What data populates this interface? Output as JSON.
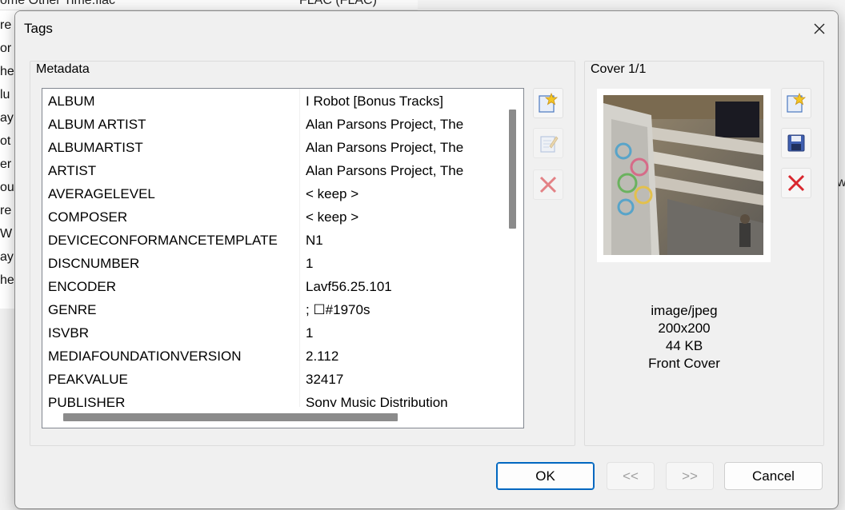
{
  "background": {
    "header_col1": "ome Other Time.flac",
    "header_col2": "FLAC (FLAC)",
    "row_fragments": [
      "re",
      "or",
      "he",
      "lu",
      "ay",
      "ot",
      "er",
      "ou",
      "re",
      "W",
      "ay",
      "he"
    ],
    "edge_text": "w"
  },
  "dialog": {
    "title": "Tags",
    "close_icon": "close-icon"
  },
  "metadata": {
    "group_label": "Metadata",
    "rows": [
      {
        "name": "ALBUM",
        "value": "I Robot [Bonus Tracks]"
      },
      {
        "name": "ALBUM ARTIST",
        "value": "Alan Parsons Project, The"
      },
      {
        "name": "ALBUMARTIST",
        "value": "Alan Parsons Project, The"
      },
      {
        "name": "ARTIST",
        "value": "Alan Parsons Project, The"
      },
      {
        "name": "AVERAGELEVEL",
        "value": "< keep >"
      },
      {
        "name": "COMPOSER",
        "value": "< keep >"
      },
      {
        "name": "DEVICECONFORMANCETEMPLATE",
        "value": "N1"
      },
      {
        "name": "DISCNUMBER",
        "value": "1"
      },
      {
        "name": "ENCODER",
        "value": "Lavf56.25.101"
      },
      {
        "name": "GENRE",
        "value": "; ☐#1970s"
      },
      {
        "name": "ISVBR",
        "value": "1"
      },
      {
        "name": "MEDIAFOUNDATIONVERSION",
        "value": "2.112"
      },
      {
        "name": "PEAKVALUE",
        "value": "32417"
      },
      {
        "name": "PUBLISHER",
        "value": "Sony Music Distribution"
      }
    ],
    "buttons": {
      "add_icon": "add-star-icon",
      "edit_icon": "edit-note-icon",
      "delete_icon": "delete-x-icon"
    }
  },
  "cover": {
    "group_label": "Cover 1/1",
    "mime": "image/jpeg",
    "dimensions": "200x200",
    "size": "44 KB",
    "type": "Front Cover",
    "buttons": {
      "add_icon": "add-star-icon",
      "save_icon": "save-disk-icon",
      "delete_icon": "delete-x-icon"
    }
  },
  "footer": {
    "ok_label": "OK",
    "prev_label": "<<",
    "next_label": ">>",
    "cancel_label": "Cancel"
  },
  "colors": {
    "accent": "#0067c0",
    "delete_red": "#d9272e",
    "scrollbar": "#8b8b8b"
  }
}
